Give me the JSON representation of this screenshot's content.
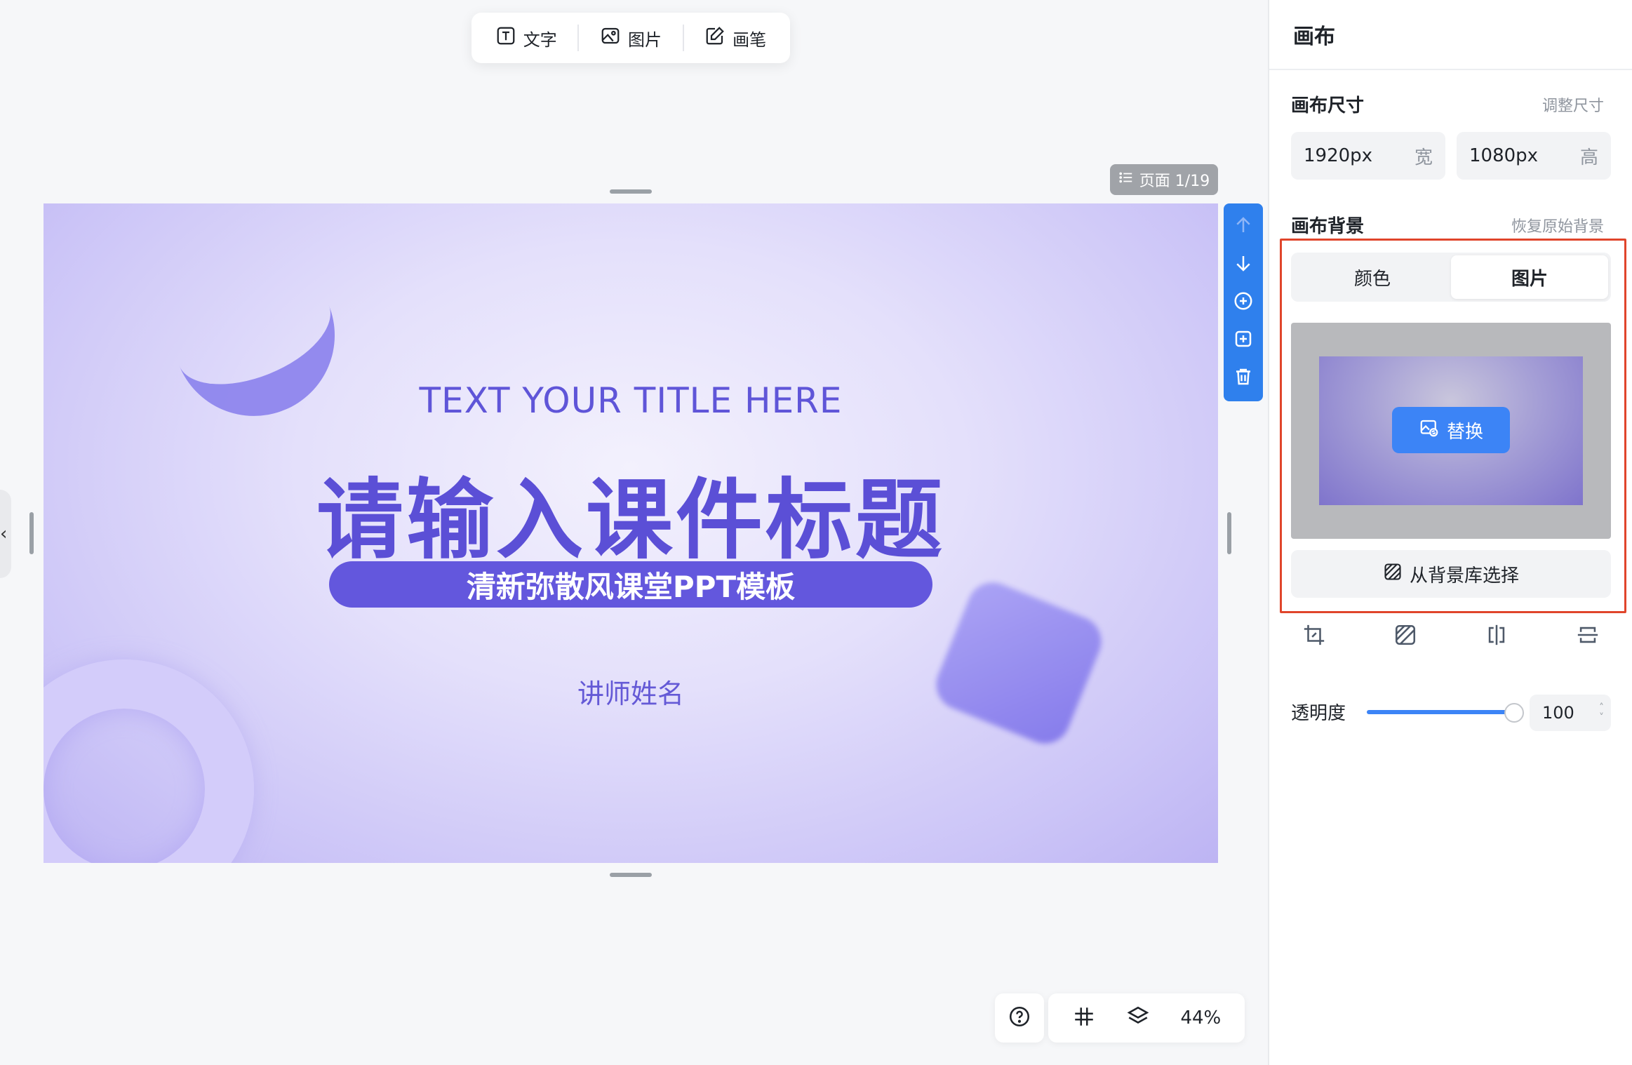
{
  "toolbar": {
    "text_label": "文字",
    "image_label": "图片",
    "pen_label": "画笔"
  },
  "page_indicator": "页面 1/19",
  "slide": {
    "en_title": "TEXT YOUR TITLE HERE",
    "cn_title": "请输入课件标题",
    "subtitle": "清新弥散风课堂PPT模板",
    "teacher": "讲师姓名"
  },
  "zoom": "44%",
  "panel": {
    "title": "画布",
    "size_section": "画布尺寸",
    "size_link": "调整尺寸",
    "width_value": "1920px",
    "width_unit": "宽",
    "height_value": "1080px",
    "height_unit": "高",
    "bg_section": "画布背景",
    "bg_link": "恢复原始背景",
    "tabs": [
      "颜色",
      "图片"
    ],
    "active_tab": "图片",
    "replace_label": "替换",
    "library_label": "从背景库选择",
    "opacity_label": "透明度",
    "opacity_value": "100",
    "opacity_level": 1.0
  },
  "colors": {
    "accent": "#3c84f6",
    "slide_purple": "#5b4fd6",
    "highlight": "#e0452b"
  },
  "icons": [
    "text-icon",
    "image-icon",
    "pen-icon",
    "list-icon",
    "arrow-up-icon",
    "arrow-down-icon",
    "add-circle-icon",
    "duplicate-icon",
    "trash-icon",
    "help-icon",
    "grid-icon",
    "layers-icon",
    "crop-icon",
    "pattern-icon",
    "flip-horizontal-icon",
    "flip-vertical-icon"
  ]
}
